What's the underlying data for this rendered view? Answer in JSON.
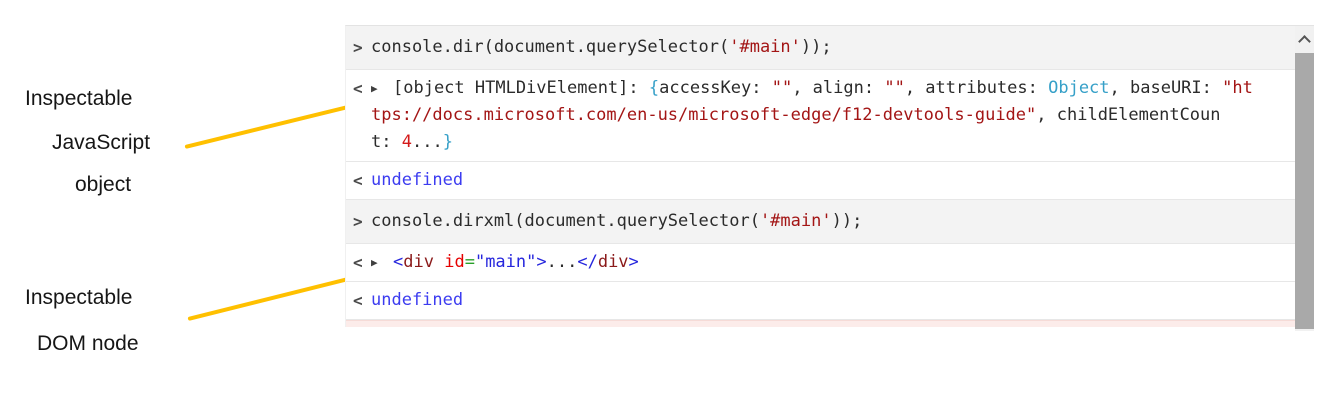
{
  "annotations": {
    "js_object": {
      "lines": [
        "Inspectable",
        "JavaScript",
        "object"
      ]
    },
    "dom_node": {
      "lines": [
        "Inspectable",
        "DOM node"
      ]
    }
  },
  "colors": {
    "code": "#2b2b2b",
    "string": "#a31515",
    "number": "#d41a1a",
    "cyan": "#36a0c8",
    "undef": "#3c3cf0",
    "tag": "#8b1a1a",
    "attr": "#e50000",
    "equals": "#28a028",
    "blue": "#2626dd",
    "gold": "#FFC000",
    "input_row_bg": "#f3f3f3",
    "scroll_thumb": "#a9a9a9",
    "scroll_track": "#f1f1f1",
    "pink_strip": "#fcecea"
  },
  "console": {
    "prompt_in": ">",
    "prompt_out": "<",
    "expander": "▶",
    "rows": [
      {
        "type": "input",
        "segments": [
          {
            "t": "console.dir(document.querySelector(",
            "c": "code"
          },
          {
            "t": "'#main'",
            "c": "string"
          },
          {
            "t": "));",
            "c": "code"
          }
        ]
      },
      {
        "type": "result",
        "expandable": true,
        "lines": [
          [
            {
              "t": "[object HTMLDivElement]: ",
              "c": "code"
            },
            {
              "t": "{",
              "c": "cyan"
            },
            {
              "t": "accessKey: ",
              "c": "code"
            },
            {
              "t": "\"\"",
              "c": "string"
            },
            {
              "t": ", align: ",
              "c": "code"
            },
            {
              "t": "\"\"",
              "c": "string"
            },
            {
              "t": ", attributes: ",
              "c": "code"
            },
            {
              "t": "Object",
              "c": "cyan"
            },
            {
              "t": ", baseURI: ",
              "c": "code"
            },
            {
              "t": "\"ht",
              "c": "string"
            }
          ],
          [
            {
              "t": "tps://docs.microsoft.com/en-us/microsoft-edge/f12-devtools-guide\"",
              "c": "string"
            },
            {
              "t": ", childElementCoun",
              "c": "code"
            }
          ],
          [
            {
              "t": "t: ",
              "c": "code"
            },
            {
              "t": "4",
              "c": "number"
            },
            {
              "t": "...",
              "c": "code"
            },
            {
              "t": "}",
              "c": "cyan"
            }
          ]
        ]
      },
      {
        "type": "result",
        "segments": [
          {
            "t": "undefined",
            "c": "undef"
          }
        ]
      },
      {
        "type": "input",
        "segments": [
          {
            "t": "console.dirxml(document.querySelector(",
            "c": "code"
          },
          {
            "t": "'#main'",
            "c": "string"
          },
          {
            "t": "));",
            "c": "code"
          }
        ]
      },
      {
        "type": "result",
        "expandable": true,
        "lines": [
          [
            {
              "t": "<",
              "c": "blue"
            },
            {
              "t": "div",
              "c": "tag"
            },
            {
              "t": " ",
              "c": "code"
            },
            {
              "t": "id",
              "c": "attr"
            },
            {
              "t": "=",
              "c": "equals"
            },
            {
              "t": "\"main\"",
              "c": "blue"
            },
            {
              "t": ">",
              "c": "blue"
            },
            {
              "t": "...",
              "c": "code"
            },
            {
              "t": "</",
              "c": "blue"
            },
            {
              "t": "div",
              "c": "tag"
            },
            {
              "t": ">",
              "c": "blue"
            }
          ]
        ]
      },
      {
        "type": "result",
        "segments": [
          {
            "t": "undefined",
            "c": "undef"
          }
        ]
      }
    ]
  }
}
